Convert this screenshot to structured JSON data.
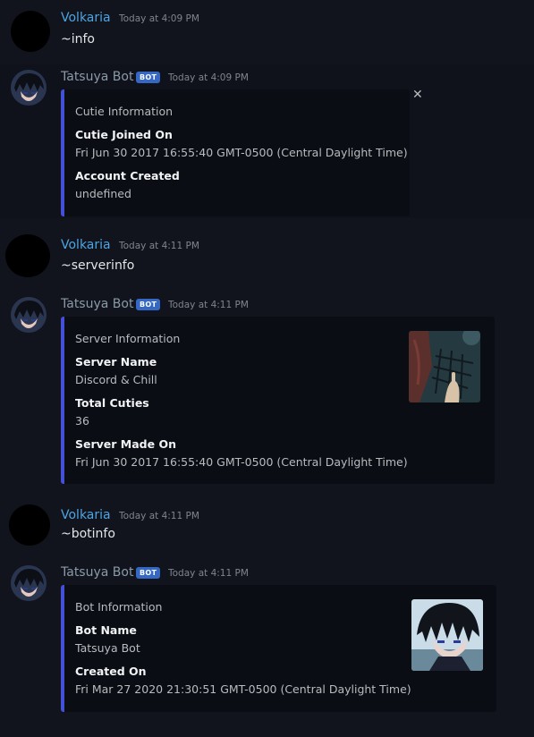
{
  "messages": [
    {
      "author": "Volkaria",
      "time": "Today at 4:09 PM",
      "text": "~info"
    },
    {
      "author": "Tatsuya Bot",
      "badge": "BOT",
      "time": "Today at 4:09 PM",
      "embed": {
        "title": "Cutie Information",
        "fields": [
          {
            "name": "Cutie Joined On",
            "value": "Fri Jun 30 2017 16:55:40 GMT-0500 (Central Daylight Time)"
          },
          {
            "name": "Account Created",
            "value": "undefined"
          }
        ]
      }
    },
    {
      "author": "Volkaria",
      "time": "Today at 4:11 PM",
      "text": "~serverinfo"
    },
    {
      "author": "Tatsuya Bot",
      "badge": "BOT",
      "time": "Today at 4:11 PM",
      "embed": {
        "title": "Server Information",
        "fields": [
          {
            "name": "Server Name",
            "value": "Discord & Chill"
          },
          {
            "name": "Total Cuties",
            "value": "36"
          },
          {
            "name": "Server Made On",
            "value": "Fri Jun 30 2017 16:55:40 GMT-0500 (Central Daylight Time)"
          }
        ]
      }
    },
    {
      "author": "Volkaria",
      "time": "Today at 4:11 PM",
      "text": "~botinfo"
    },
    {
      "author": "Tatsuya Bot",
      "badge": "BOT",
      "time": "Today at 4:11 PM",
      "embed": {
        "title": "Bot Information",
        "fields": [
          {
            "name": "Bot Name",
            "value": "Tatsuya Bot"
          },
          {
            "name": "Created On",
            "value": "Fri Mar 27 2020 21:30:51 GMT-0500 (Central Daylight Time)"
          }
        ]
      }
    }
  ],
  "icons": {
    "close": "close-icon"
  },
  "colors": {
    "background": "#11141c",
    "embed_accent": "#4450d8",
    "username": "#4ea4e3",
    "bot_badge": "#3567c5"
  }
}
